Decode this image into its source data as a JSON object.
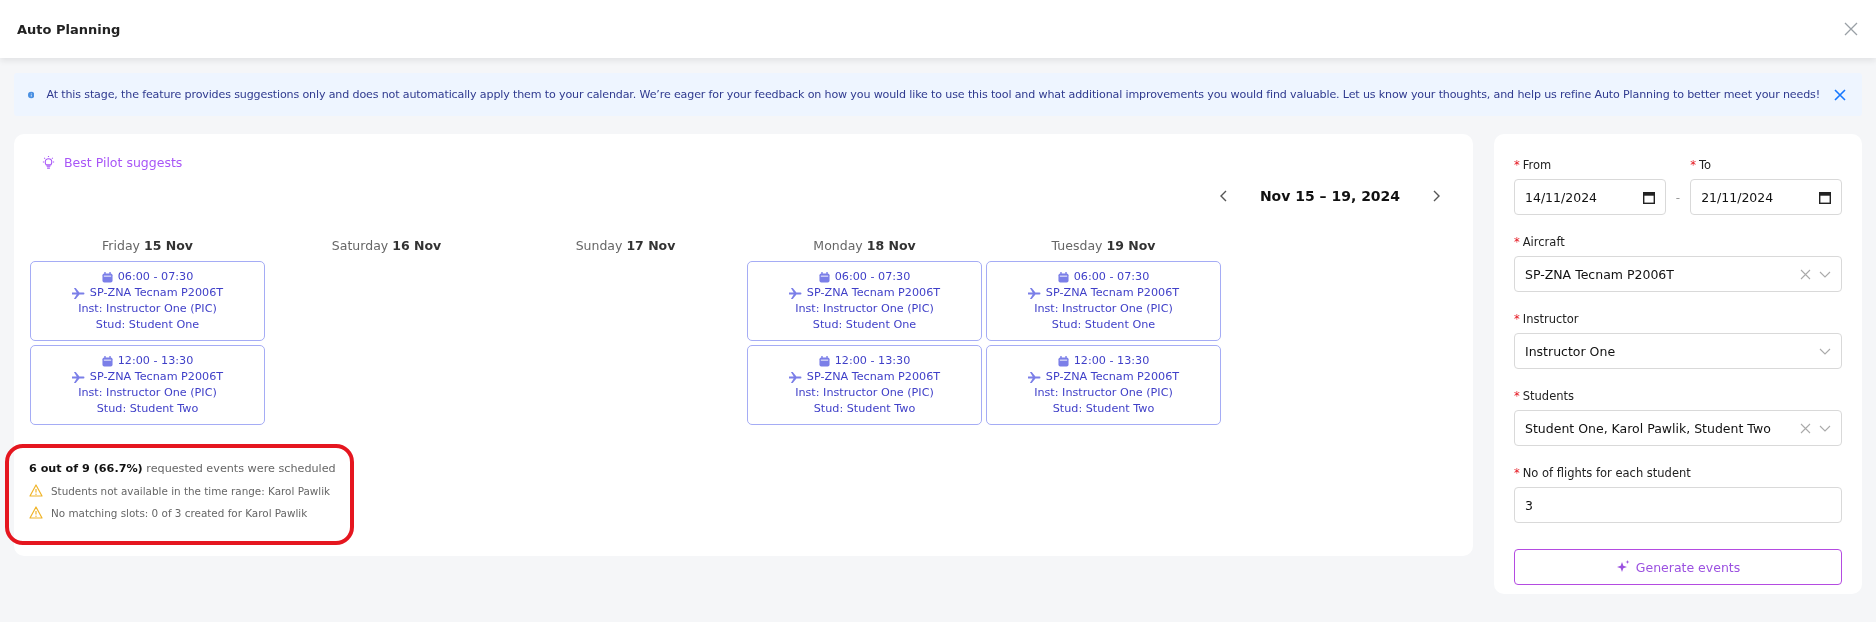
{
  "window": {
    "title": "Auto Planning"
  },
  "info_banner": {
    "text": "At this stage, the feature provides suggestions only and does not automatically apply them to your calendar. We’re eager for your feedback on how you would like to use this tool and what additional improvements you would find valuable. Let us know your thoughts, and help us refine Auto Planning to better meet your needs!"
  },
  "suggestions": {
    "heading": "Best Pilot suggests",
    "range": "Nov 15 – 19, 2024",
    "days": [
      {
        "weekday": "Friday",
        "date": "15 Nov",
        "events": [
          {
            "time": "06:00 - 07:30",
            "aircraft": "SP-ZNA Tecnam P2006T",
            "instructor": "Inst: Instructor One (PIC)",
            "student": "Stud: Student One"
          },
          {
            "time": "12:00 - 13:30",
            "aircraft": "SP-ZNA Tecnam P2006T",
            "instructor": "Inst: Instructor One (PIC)",
            "student": "Stud: Student Two"
          }
        ]
      },
      {
        "weekday": "Saturday",
        "date": "16 Nov"
      },
      {
        "weekday": "Sunday",
        "date": "17 Nov"
      },
      {
        "weekday": "Monday",
        "date": "18 Nov",
        "events": [
          {
            "time": "06:00 - 07:30",
            "aircraft": "SP-ZNA Tecnam P2006T",
            "instructor": "Inst: Instructor One (PIC)",
            "student": "Stud: Student One"
          },
          {
            "time": "12:00 - 13:30",
            "aircraft": "SP-ZNA Tecnam P2006T",
            "instructor": "Inst: Instructor One (PIC)",
            "student": "Stud: Student Two"
          }
        ]
      },
      {
        "weekday": "Tuesday",
        "date": "19 Nov",
        "events": [
          {
            "time": "06:00 - 07:30",
            "aircraft": "SP-ZNA Tecnam P2006T",
            "instructor": "Inst: Instructor One (PIC)",
            "student": "Stud: Student One"
          },
          {
            "time": "12:00 - 13:30",
            "aircraft": "SP-ZNA Tecnam P2006T",
            "instructor": "Inst: Instructor One (PIC)",
            "student": "Stud: Student Two"
          }
        ]
      }
    ],
    "summary": {
      "text": "**6 out of 9 (66.7%)** requested events were scheduled",
      "warnings": [
        "Students not available in the time range: Karol Pawlik",
        "No matching slots: 0 of 3 created for Karol Pawlik"
      ]
    }
  },
  "form": {
    "from": {
      "required_mark": "*",
      "label": "From",
      "value": "14/11/2024"
    },
    "separator": "-",
    "to": {
      "required_mark": "*",
      "label": "To",
      "value": "21/11/2024"
    },
    "fields": [
      {
        "kind": "select",
        "required_mark": "*",
        "label": "Aircraft",
        "value": "SP-ZNA Tecnam P2006T",
        "clearable": true
      },
      {
        "kind": "select",
        "required_mark": "*",
        "label": "Instructor",
        "value": "Instructor One",
        "clearable": false
      },
      {
        "kind": "select",
        "required_mark": "*",
        "label": "Students",
        "value": "Student One, Karol Pawlik, Student Two",
        "clearable": true
      },
      {
        "kind": "number",
        "required_mark": "*",
        "label": "No of flights for each student",
        "value": "3"
      }
    ],
    "button": "Generate events"
  }
}
